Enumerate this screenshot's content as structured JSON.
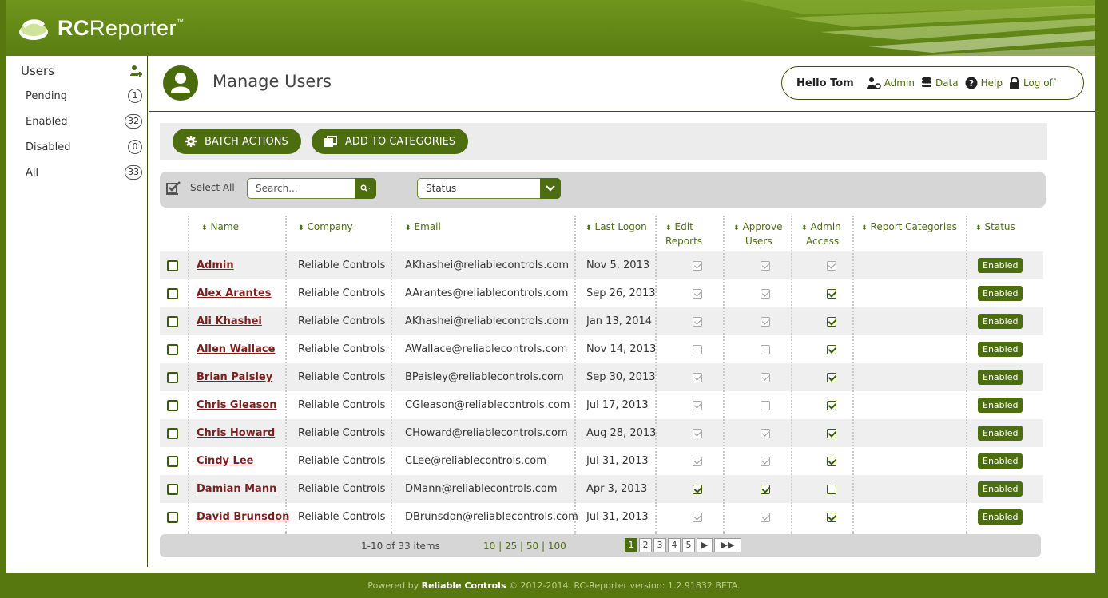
{
  "app": {
    "logo_bold": "RC",
    "logo_light": "Reporter",
    "logo_tm": "™"
  },
  "sidebar": {
    "title": "Users",
    "items": [
      {
        "label": "Pending",
        "count": "1"
      },
      {
        "label": "Enabled",
        "count": "32"
      },
      {
        "label": "Disabled",
        "count": "0"
      },
      {
        "label": "All",
        "count": "33"
      }
    ]
  },
  "header": {
    "title": "Manage Users",
    "greeting": "Hello Tom",
    "links": {
      "admin": "Admin",
      "data": "Data",
      "help": "Help",
      "logoff": "Log off"
    }
  },
  "actions": {
    "batch": "BATCH ACTIONS",
    "categories": "ADD TO CATEGORIES"
  },
  "filters": {
    "select_all": "Select All",
    "search_placeholder": "Search...",
    "status_label": "Status"
  },
  "table": {
    "columns": {
      "name": "Name",
      "company": "Company",
      "email": "Email",
      "last_logon": "Last Logon",
      "edit_reports_1": "Edit",
      "edit_reports_2": "Reports",
      "approve_users_1": "Approve",
      "approve_users_2": "Users",
      "admin_access_1": "Admin",
      "admin_access_2": "Access",
      "report_categories": "Report Categories",
      "status": "Status"
    },
    "rows": [
      {
        "name": "Admin",
        "company": "Reliable Controls",
        "email": "AKhashei@reliablecontrols.com",
        "last_logon": "Nov 5, 2013",
        "edit": true,
        "approve": true,
        "admin": true,
        "admin_style": "grey",
        "edit_style": "grey",
        "approve_style": "grey",
        "status": "Enabled"
      },
      {
        "name": "Alex Arantes",
        "company": "Reliable Controls",
        "email": "AArantes@reliablecontrols.com",
        "last_logon": "Sep 26, 2013",
        "edit": true,
        "approve": true,
        "admin": true,
        "admin_style": "green",
        "edit_style": "grey",
        "approve_style": "grey",
        "status": "Enabled"
      },
      {
        "name": "Ali Khashei",
        "company": "Reliable Controls",
        "email": "AKhashei@reliablecontrols.com",
        "last_logon": "Jan 13, 2014",
        "edit": true,
        "approve": true,
        "admin": true,
        "admin_style": "green",
        "edit_style": "grey",
        "approve_style": "grey",
        "status": "Enabled"
      },
      {
        "name": "Allen Wallace",
        "company": "Reliable Controls",
        "email": "AWallace@reliablecontrols.com",
        "last_logon": "Nov 14, 2013",
        "edit": false,
        "approve": false,
        "admin": true,
        "admin_style": "green",
        "edit_style": "grey",
        "approve_style": "grey",
        "status": "Enabled"
      },
      {
        "name": "Brian Paisley",
        "company": "Reliable Controls",
        "email": "BPaisley@reliablecontrols.com",
        "last_logon": "Sep 30, 2013",
        "edit": true,
        "approve": true,
        "admin": true,
        "admin_style": "green",
        "edit_style": "grey",
        "approve_style": "grey",
        "status": "Enabled"
      },
      {
        "name": "Chris Gleason",
        "company": "Reliable Controls",
        "email": "CGleason@reliablecontrols.com",
        "last_logon": "Jul 17, 2013",
        "edit": true,
        "approve": false,
        "admin": true,
        "admin_style": "green",
        "edit_style": "grey",
        "approve_style": "grey",
        "status": "Enabled"
      },
      {
        "name": "Chris Howard",
        "company": "Reliable Controls",
        "email": "CHoward@reliablecontrols.com",
        "last_logon": "Aug 28, 2013",
        "edit": true,
        "approve": true,
        "admin": true,
        "admin_style": "green",
        "edit_style": "grey",
        "approve_style": "grey",
        "status": "Enabled"
      },
      {
        "name": "Cindy Lee",
        "company": "Reliable Controls",
        "email": "CLee@reliablecontrols.com",
        "last_logon": "Jul 31, 2013",
        "edit": true,
        "approve": true,
        "admin": true,
        "admin_style": "green",
        "edit_style": "grey",
        "approve_style": "grey",
        "status": "Enabled"
      },
      {
        "name": "Damian Mann",
        "company": "Reliable Controls",
        "email": "DMann@reliablecontrols.com",
        "last_logon": "Apr 3, 2013",
        "edit": true,
        "approve": true,
        "admin": false,
        "admin_style": "green",
        "edit_style": "green",
        "approve_style": "green",
        "status": "Enabled"
      },
      {
        "name": "David Brunsdon",
        "company": "Reliable Controls",
        "email": "DBrunsdon@reliablecontrols.com",
        "last_logon": "Jul 31, 2013",
        "edit": true,
        "approve": true,
        "admin": true,
        "admin_style": "green",
        "edit_style": "grey",
        "approve_style": "grey",
        "status": "Enabled"
      }
    ]
  },
  "pager": {
    "info": "1-10 of 33 items",
    "size_10": "10",
    "size_25": "25",
    "size_50": "50",
    "size_100": "100",
    "pages": [
      "1",
      "2",
      "3",
      "4",
      "5"
    ],
    "current": "1",
    "next": "▶",
    "last": "▶▶"
  },
  "footer": {
    "prefix": "Powered by",
    "brand": "Reliable Controls",
    "suffix": "© 2012-2014. RC-Reporter version: 1.2.91832 BETA."
  },
  "colors": {
    "brand_green": "#56780f",
    "button_green": "#4c6d10",
    "name_link": "#7b1f1f"
  },
  "icons": [
    "logo-mark-icon",
    "add-user-icon",
    "user-avatar-icon",
    "admin-icon",
    "data-icon",
    "help-icon",
    "lock-icon",
    "gear-icon",
    "categories-icon",
    "select-all-icon",
    "search-icon",
    "chevron-down-icon",
    "sort-icon"
  ]
}
